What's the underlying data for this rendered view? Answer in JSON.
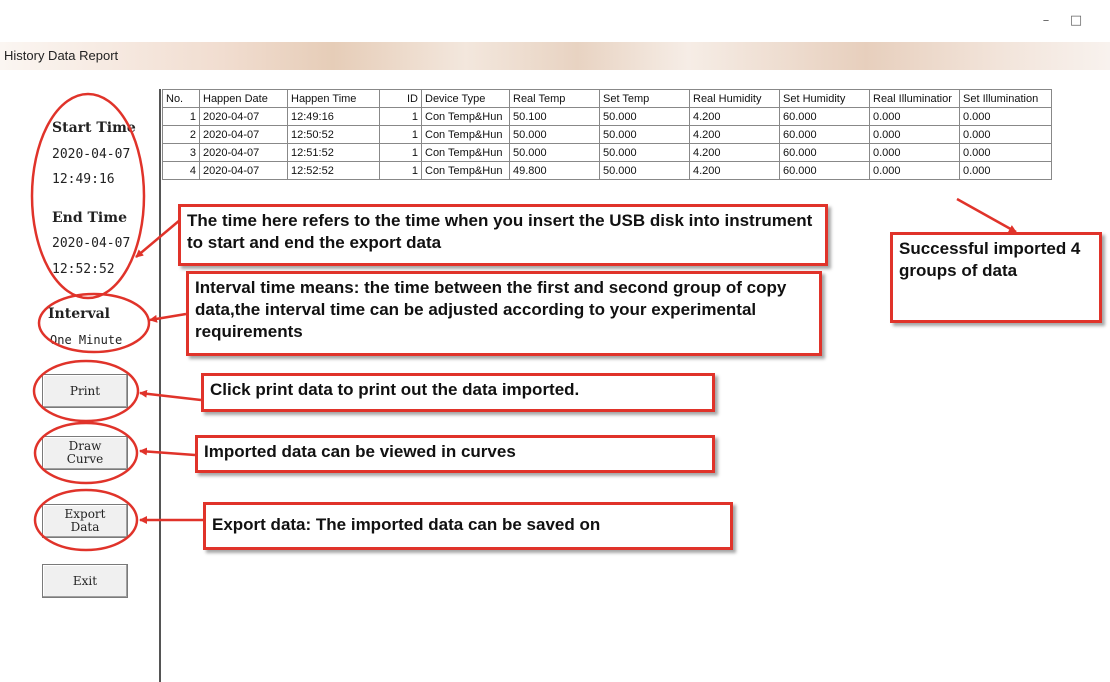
{
  "window": {
    "minimize_glyph": "–",
    "maximize_glyph": "□",
    "title": "History Data Report"
  },
  "sidebar": {
    "start_label": "Start Time",
    "start_date": "2020-04-07",
    "start_time": "12:49:16",
    "end_label": "End Time",
    "end_date": "2020-04-07",
    "end_time": "12:52:52",
    "interval_label": "Interval",
    "interval_value": "One Minute",
    "print_button": "Print",
    "draw_curve_button": "Draw Curve",
    "export_button": "Export Data",
    "exit_button": "Exit"
  },
  "table": {
    "headers": [
      "No.",
      "Happen Date",
      "Happen Time",
      "ID",
      "Device Type",
      "Real Temp",
      "Set Temp",
      "Real Humidity",
      "Set Humidity",
      "Real Illuminatior",
      "Set Illumination"
    ],
    "rows": [
      [
        "1",
        "2020-04-07",
        "12:49:16",
        "1",
        "Con Temp&Hun",
        "50.100",
        "50.000",
        "4.200",
        "60.000",
        "0.000",
        "0.000"
      ],
      [
        "2",
        "2020-04-07",
        "12:50:52",
        "1",
        "Con Temp&Hun",
        "50.000",
        "50.000",
        "4.200",
        "60.000",
        "0.000",
        "0.000"
      ],
      [
        "3",
        "2020-04-07",
        "12:51:52",
        "1",
        "Con Temp&Hun",
        "50.000",
        "50.000",
        "4.200",
        "60.000",
        "0.000",
        "0.000"
      ],
      [
        "4",
        "2020-04-07",
        "12:52:52",
        "1",
        "Con Temp&Hun",
        "49.800",
        "50.000",
        "4.200",
        "60.000",
        "0.000",
        "0.000"
      ]
    ]
  },
  "annotations": {
    "time_note": "The time here refers to the time when you insert the USB disk into instrument to start and end the export data",
    "interval_note": "Interval time means: the time between the first and second group of copy data,the interval time can be adjusted according to your experimental requirements",
    "print_note": "Click print data to print out the data imported.",
    "curve_note": "Imported data can be viewed in curves",
    "export_note": "Export data: The imported data can be saved on",
    "success_note": "Successful imported 4 groups of data",
    "annotation_color": "#e0332a"
  }
}
